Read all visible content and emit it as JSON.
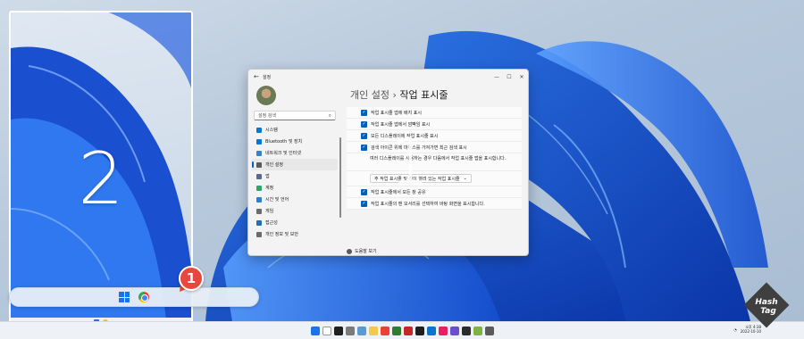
{
  "display2": {
    "number": "2"
  },
  "display1": {
    "number": "1"
  },
  "badge": {
    "label": "1"
  },
  "settings": {
    "title": "설정",
    "back_icon": "back-arrow-icon",
    "search_placeholder": "설정 검색",
    "breadcrumb_parent": "개인 설정",
    "breadcrumb_sep": "›",
    "page_title": "작업 표시줄",
    "nav": [
      {
        "label": "시스템",
        "color": "#0078d4"
      },
      {
        "label": "Bluetooth 및 장치",
        "color": "#0078d4"
      },
      {
        "label": "네트워크 및 인터넷",
        "color": "#3b82c4"
      },
      {
        "label": "개인 설정",
        "color": "#5b5b5b",
        "active": true
      },
      {
        "label": "앱",
        "color": "#5a6a8a"
      },
      {
        "label": "계정",
        "color": "#2ea36b"
      },
      {
        "label": "시간 및 언어",
        "color": "#2b7fd0"
      },
      {
        "label": "게임",
        "color": "#6b6b6b"
      },
      {
        "label": "접근성",
        "color": "#1f6fb5"
      },
      {
        "label": "개인 정보 및 보안",
        "color": "#6b6b6b"
      }
    ],
    "rows": [
      {
        "type": "check",
        "label": "작업 표시줄 앱에 배지 표시"
      },
      {
        "type": "check",
        "label": "작업 표시줄 앱에서 깜빡임 표시"
      },
      {
        "type": "check",
        "label": "모든 디스플레이에 작업 표시줄 표시"
      },
      {
        "type": "check",
        "label": "검색 아이콘 위에 마우스를 가져가면 최근 검색 표시"
      },
      {
        "type": "text",
        "label": "여러 디스플레이를 사용하는 경우 다음에서 작업 표시줄 앱을 표시합니다."
      },
      {
        "type": "dropdown",
        "label": "주 작업 표시줄 및 창이 열려 있는 작업 표시줄"
      },
      {
        "type": "check",
        "label": "작업 표시줄에서 모든 창 공유"
      },
      {
        "type": "check",
        "label": "작업 표시줄의 맨 모서리를 선택하여 바탕 화면을 표시합니다."
      }
    ],
    "help_label": "도움말 보기"
  },
  "taskbar": {
    "icon_colors": [
      "#1a73e8",
      "#ffffff",
      "#1f1f1f",
      "#7a7a7a",
      "#5b9bd5",
      "#f2c94c",
      "#ea4335",
      "#2e7d32",
      "#c62828",
      "#1f1f1f",
      "#0b74d1",
      "#e91e63",
      "#6d4cd4",
      "#2b2b2b",
      "#7cb342",
      "#5b5b5b"
    ],
    "clock_time": "오후 4:38",
    "clock_date": "2022-10-10"
  },
  "watermark": {
    "line1": "Hash",
    "line2": "Tag"
  }
}
